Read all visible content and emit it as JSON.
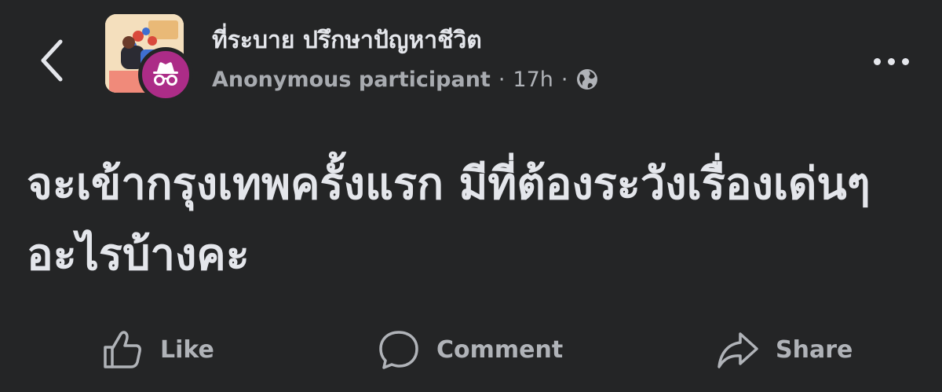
{
  "header": {
    "group_name": "ที่ระบาย ปรึกษาปัญหาชีวิต",
    "author": "Anonymous participant",
    "separator": "·",
    "time": "17h",
    "privacy_icon": "globe-icon",
    "back_icon": "chevron-left-icon",
    "more_icon": "more-horizontal-icon",
    "badge_color": "#ac2c87"
  },
  "post": {
    "text": "จะเข้ากรุงเทพครั้งแรก มีที่ต้องระวังเรื่องเด่นๆอะไรบ้างคะ"
  },
  "actions": {
    "like": "Like",
    "comment": "Comment",
    "share": "Share"
  }
}
